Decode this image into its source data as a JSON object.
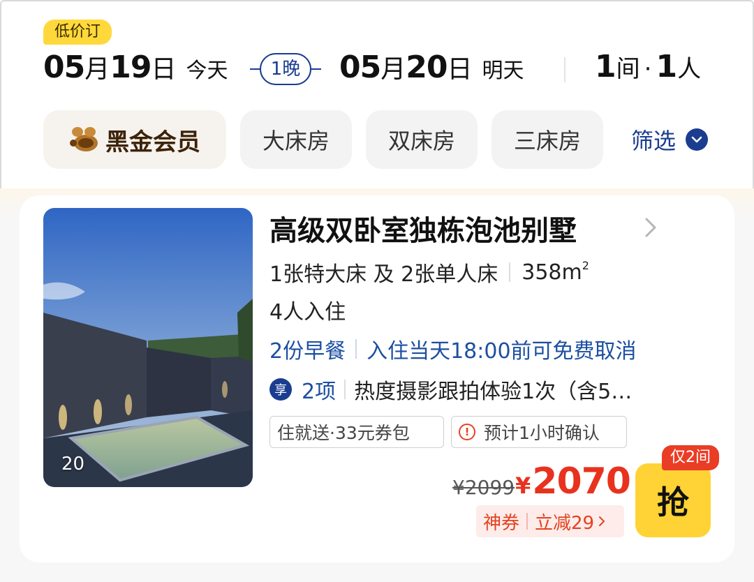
{
  "booking": {
    "promo_label": "低价订",
    "checkin": {
      "month": "05",
      "month_unit": "月",
      "day": "19",
      "day_unit": "日",
      "weekday": "今天"
    },
    "nights_label": "1晚",
    "checkout": {
      "month": "05",
      "month_unit": "月",
      "day": "20",
      "day_unit": "日",
      "weekday": "明天"
    },
    "occupancy": {
      "rooms": "1",
      "rooms_unit": "间",
      "separator": "·",
      "guests": "1",
      "guests_unit": "人"
    }
  },
  "filters": {
    "member_label": "黑金会员",
    "chips": [
      "大床房",
      "双床房",
      "三床房"
    ],
    "filter_label": "筛选"
  },
  "room": {
    "photo_count": "20",
    "title": "高级双卧室独栋泡池别墅",
    "beds": "1张特大床 及 2张单人床",
    "area": "358m",
    "area_sup": "2",
    "occupancy": "4人入住",
    "breakfast": "2份早餐",
    "cancellation": "入住当天18:00前可免费取消",
    "perk_badge": "享",
    "perk_count": "2项",
    "perk_desc": "热度摄影跟拍体验1次（含5…",
    "tags": [
      "住就送·33元券包",
      "预计1小时确认"
    ],
    "warn_icon": "!",
    "original_price": "¥2099",
    "currency": "¥",
    "price": "2070",
    "coupon_label": "神券",
    "coupon_discount": "立减29",
    "stock_label": "仅2间",
    "book_button": "抢"
  },
  "colors": {
    "accent_blue": "#1a3d8f",
    "price_red": "#e8321e",
    "promo_yellow": "#ffd93b",
    "grab_yellow": "#ffd335"
  }
}
